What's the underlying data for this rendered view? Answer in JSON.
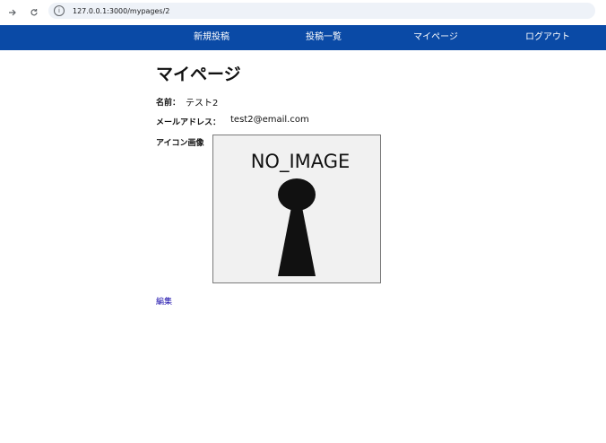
{
  "browser": {
    "url": "127.0.0.1:3000/mypages/2"
  },
  "nav": {
    "items": [
      {
        "label": "新規投稿"
      },
      {
        "label": "投稿一覧"
      },
      {
        "label": "マイページ"
      },
      {
        "label": "ログアウト"
      }
    ]
  },
  "page": {
    "title": "マイページ",
    "name_label": "名前：",
    "name_value": "テスト2",
    "email_label": "メールアドレス：",
    "email_value": "test2@email.com",
    "icon_label": "アイコン画像",
    "no_image_text": "NO_IMAGE",
    "edit_label": "編集"
  },
  "colors": {
    "nav_bg": "#0a4aa6",
    "link": "#1a0dab"
  }
}
